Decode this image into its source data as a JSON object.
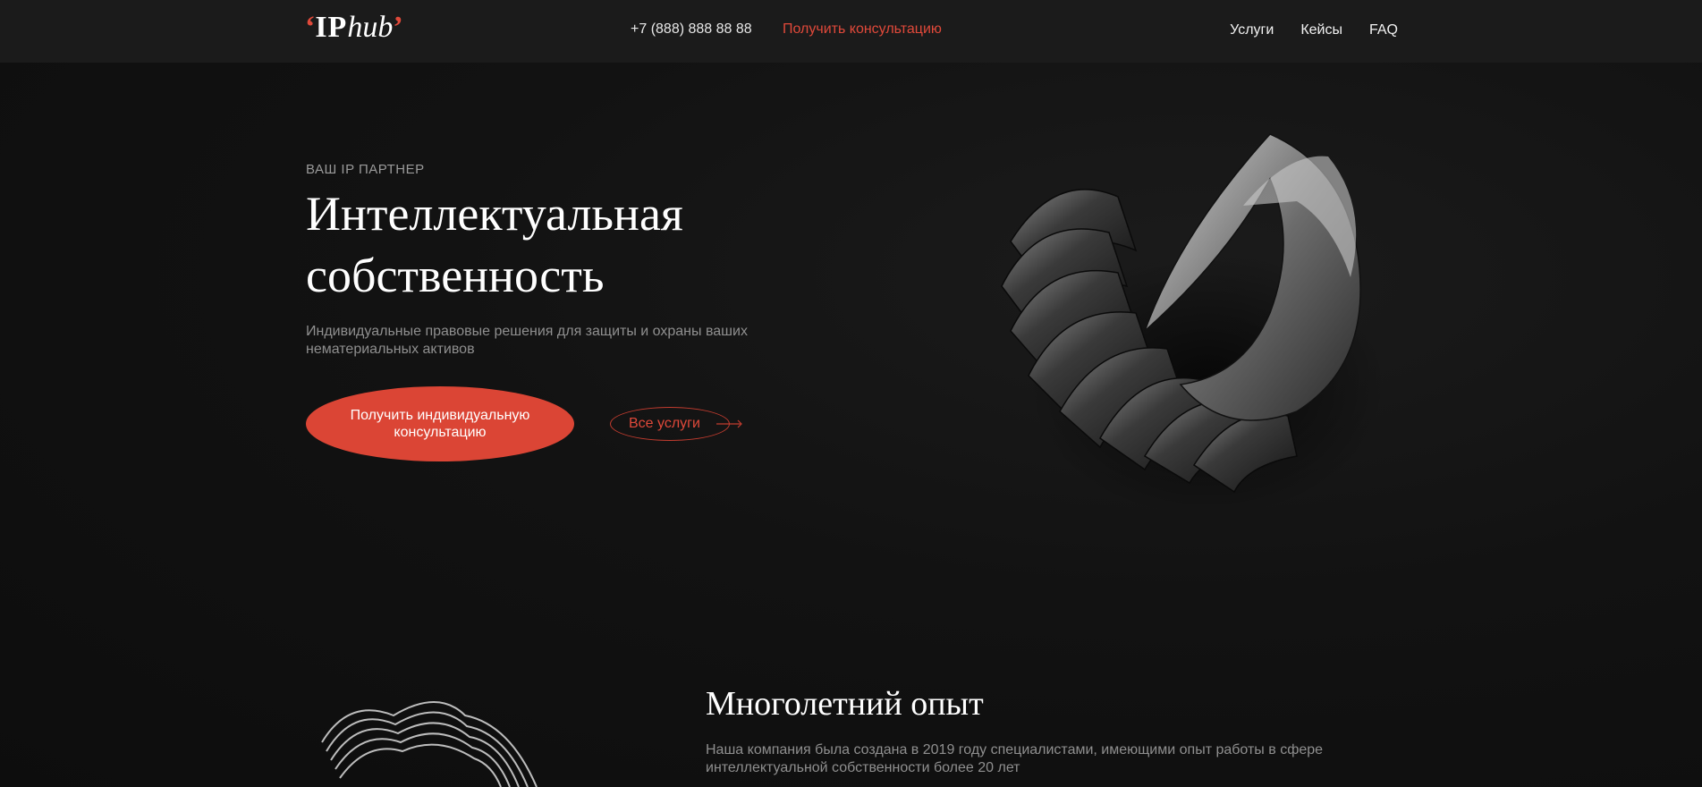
{
  "header": {
    "logo": {
      "open_quote": "‘",
      "ip": "IP",
      "hub": "hub",
      "close_quote": "’"
    },
    "phone": "+7 (888) 888 88 88",
    "consult_link": "Получить консультацию",
    "nav": [
      "Услуги",
      "Кейсы",
      "FAQ"
    ]
  },
  "hero": {
    "eyebrow": "ВАШ IP ПАРТНЕР",
    "title": "Интеллектуальная собственность",
    "subtitle": "Индивидуальные правовые решения для защиты и охраны ваших нематериальных активов",
    "cta_label": "Получить индивидуальную консультацию",
    "services_label": "Все услуги"
  },
  "experience": {
    "title": "Многолетний опыт",
    "text": "Наша компания была создана в 2019 году специалистами, имеющими опыт работы в сфере интеллектуальной собственности более 20 лет"
  },
  "colors": {
    "accent": "#db4535",
    "background": "#111111",
    "header": "#1b1b1b"
  },
  "icons": {
    "arrow": "arrow-right-icon"
  }
}
